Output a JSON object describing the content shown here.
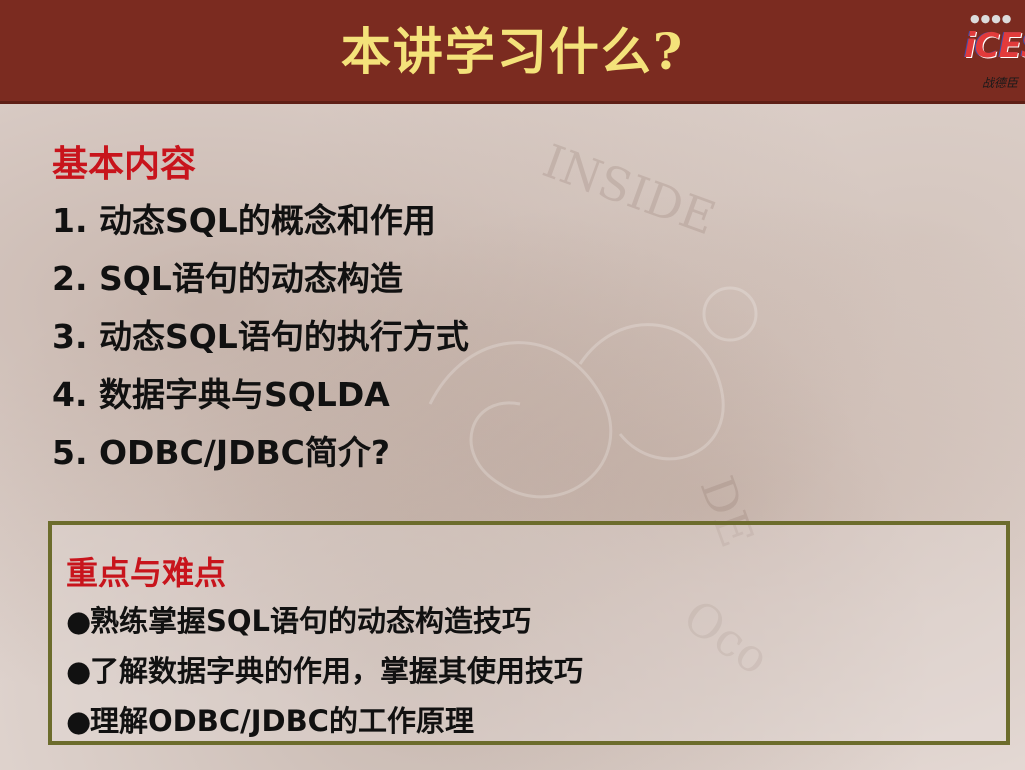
{
  "slide": {
    "title": "本讲学习什么?",
    "logo": {
      "text": "iCES",
      "subtitle": "战德臣"
    }
  },
  "basic_content": {
    "heading": "基本内容",
    "items": [
      "1. 动态SQL的概念和作用",
      "2. SQL语句的动态构造",
      "3. 动态SQL语句的执行方式",
      "4. 数据字典与SQLDA",
      "5. ODBC/JDBC简介?"
    ]
  },
  "key_points": {
    "heading": "重点与难点",
    "bullet": "●",
    "items": [
      "熟练掌握SQL语句的动态构造技巧",
      "了解数据字典的作用，掌握其使用技巧",
      "理解ODBC/JDBC的工作原理"
    ]
  },
  "colors": {
    "title_bar": "#7b2b20",
    "title_text": "#f4e27a",
    "heading_red": "#c8141c",
    "box_border": "#6c6c2c"
  }
}
